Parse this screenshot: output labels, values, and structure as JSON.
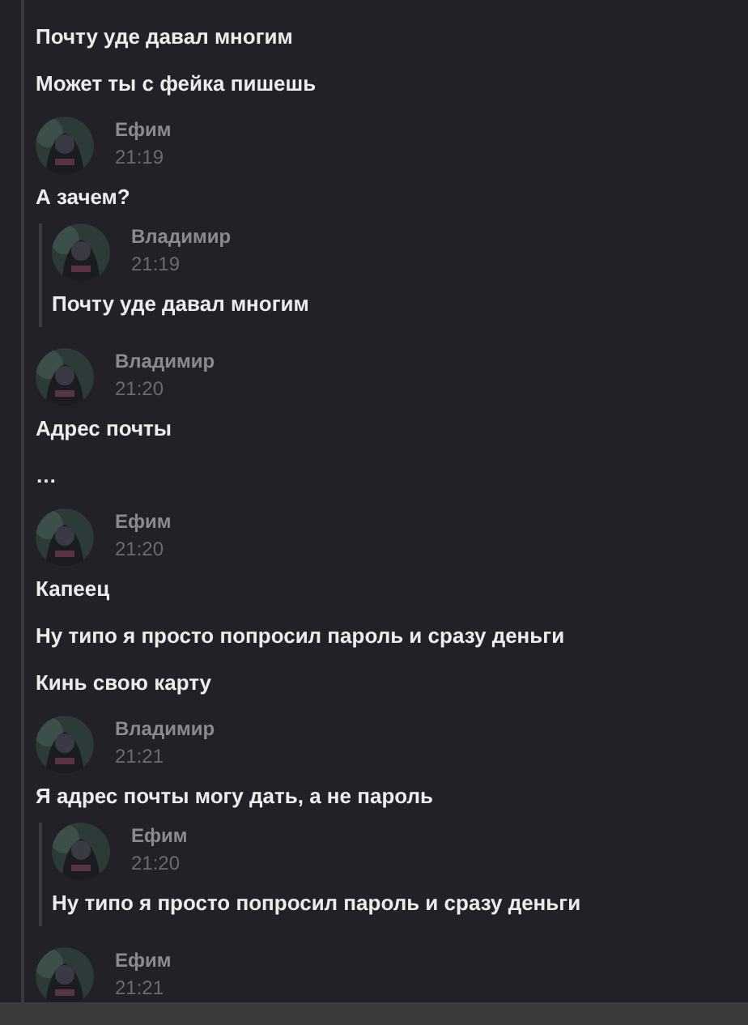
{
  "messages": [
    {
      "kind": "text",
      "text": "Почту уде давал многим"
    },
    {
      "kind": "text",
      "text": "Может ты с фейка пишешь"
    },
    {
      "kind": "header",
      "author": "Ефим",
      "time": "21:19"
    },
    {
      "kind": "text",
      "text": "А зачем?"
    },
    {
      "kind": "quote",
      "author": "Владимир",
      "time": "21:19",
      "text": "Почту уде давал многим"
    },
    {
      "kind": "header",
      "author": "Владимир",
      "time": "21:20"
    },
    {
      "kind": "text",
      "text": "Адрес почты"
    },
    {
      "kind": "text",
      "text": "…"
    },
    {
      "kind": "header",
      "author": "Ефим",
      "time": "21:20"
    },
    {
      "kind": "text",
      "text": "Капеец"
    },
    {
      "kind": "text",
      "text": "Ну типо я просто попросил пароль и сразу деньги"
    },
    {
      "kind": "text",
      "text": "Кинь свою карту"
    },
    {
      "kind": "header",
      "author": "Владимир",
      "time": "21:21"
    },
    {
      "kind": "text",
      "text": "Я адрес почты могу дать, а не пароль"
    },
    {
      "kind": "quote",
      "author": "Ефим",
      "time": "21:20",
      "text": "Ну типо я просто попросил пароль и сразу деньги"
    },
    {
      "kind": "header",
      "author": "Ефим",
      "time": "21:21"
    }
  ]
}
